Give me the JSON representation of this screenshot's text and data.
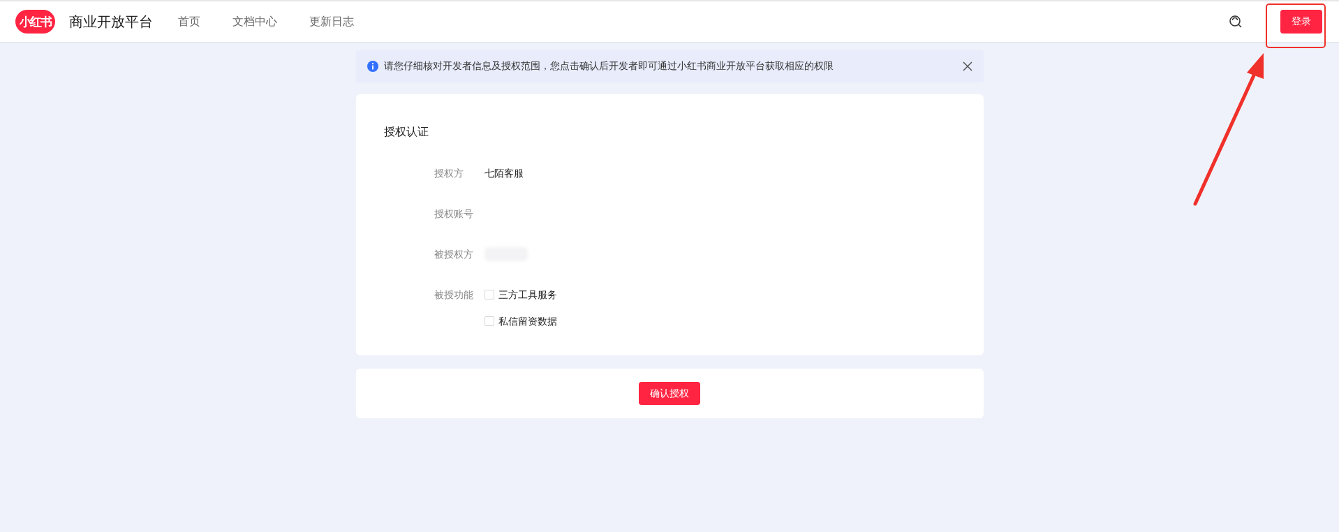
{
  "header": {
    "logo_text": "小红书",
    "platform_title": "商业开放平台",
    "nav": [
      {
        "label": "首页"
      },
      {
        "label": "文档中心"
      },
      {
        "label": "更新日志"
      }
    ],
    "login_button": "登录"
  },
  "notice": {
    "text": "请您仔细核对开发者信息及授权范围，您点击确认后开发者即可通过小红书商业开放平台获取相应的权限"
  },
  "auth_card": {
    "title": "授权认证",
    "fields": [
      {
        "kind": "text",
        "label": "授权方",
        "value": "七陌客服"
      },
      {
        "kind": "empty",
        "label": "授权账号"
      },
      {
        "kind": "redacted",
        "label": "被授权方"
      },
      {
        "kind": "checkboxes",
        "label": "被授功能",
        "options": [
          {
            "label": "三方工具服务",
            "checked": false
          },
          {
            "label": "私信留资数据",
            "checked": false
          }
        ]
      }
    ]
  },
  "confirm_button": "确认授权",
  "annotations": {
    "highlight_rectangle": true,
    "arrow": true
  }
}
